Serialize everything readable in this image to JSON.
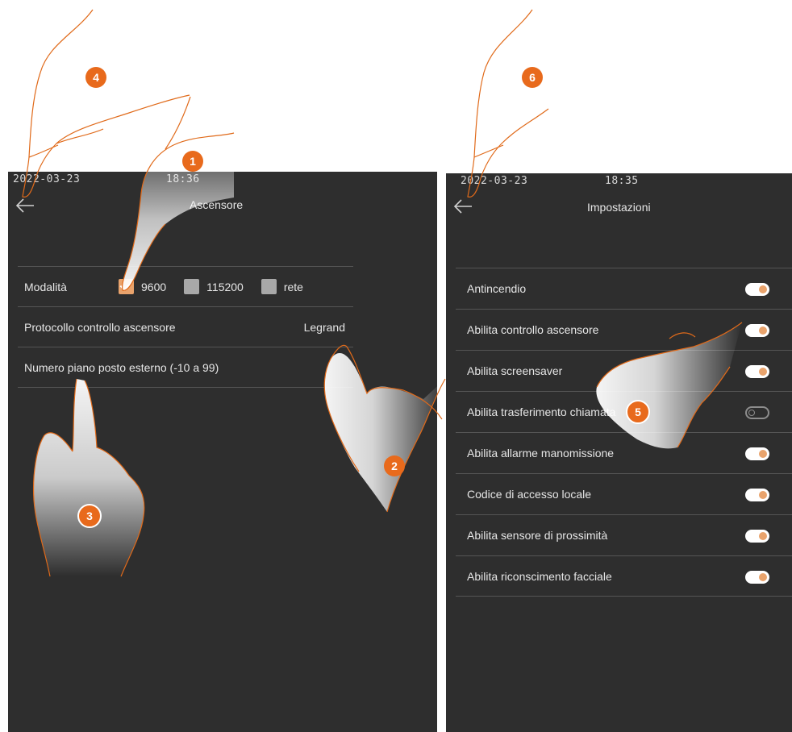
{
  "left_screen": {
    "status": {
      "date": "2022-03-23",
      "time": "18:36"
    },
    "title": "Ascensore",
    "modalita": {
      "label": "Modalità",
      "options": [
        {
          "label": "9600",
          "checked": true
        },
        {
          "label": "115200",
          "checked": false
        },
        {
          "label": "rete",
          "checked": false
        }
      ]
    },
    "protocollo": {
      "label": "Protocollo controllo ascensore",
      "value": "Legrand"
    },
    "numero_piano": {
      "label": "Numero piano posto esterno (-10 a 99)"
    }
  },
  "right_screen": {
    "status": {
      "date": "2022-03-23",
      "time": "18:35"
    },
    "title": "Impostazioni",
    "settings": [
      {
        "label": "Antincendio",
        "enabled": true
      },
      {
        "label": "Abilita controllo ascensore",
        "enabled": true
      },
      {
        "label": "Abilita screensaver",
        "enabled": true
      },
      {
        "label": "Abilita trasferimento chiamata",
        "enabled": false
      },
      {
        "label": "Abilita allarme manomissione",
        "enabled": true
      },
      {
        "label": "Codice di accesso locale",
        "enabled": true
      },
      {
        "label": "Abilita sensore di prossimità",
        "enabled": true
      },
      {
        "label": "Abilita riconscimento facciale",
        "enabled": true
      }
    ]
  },
  "step_badges": [
    "1",
    "2",
    "3",
    "4",
    "5",
    "6"
  ],
  "colors": {
    "screen_bg": "#2e2e2e",
    "accent": "#e9a36c",
    "badge": "#e86a1c",
    "hand_outline": "#e06a1a"
  }
}
